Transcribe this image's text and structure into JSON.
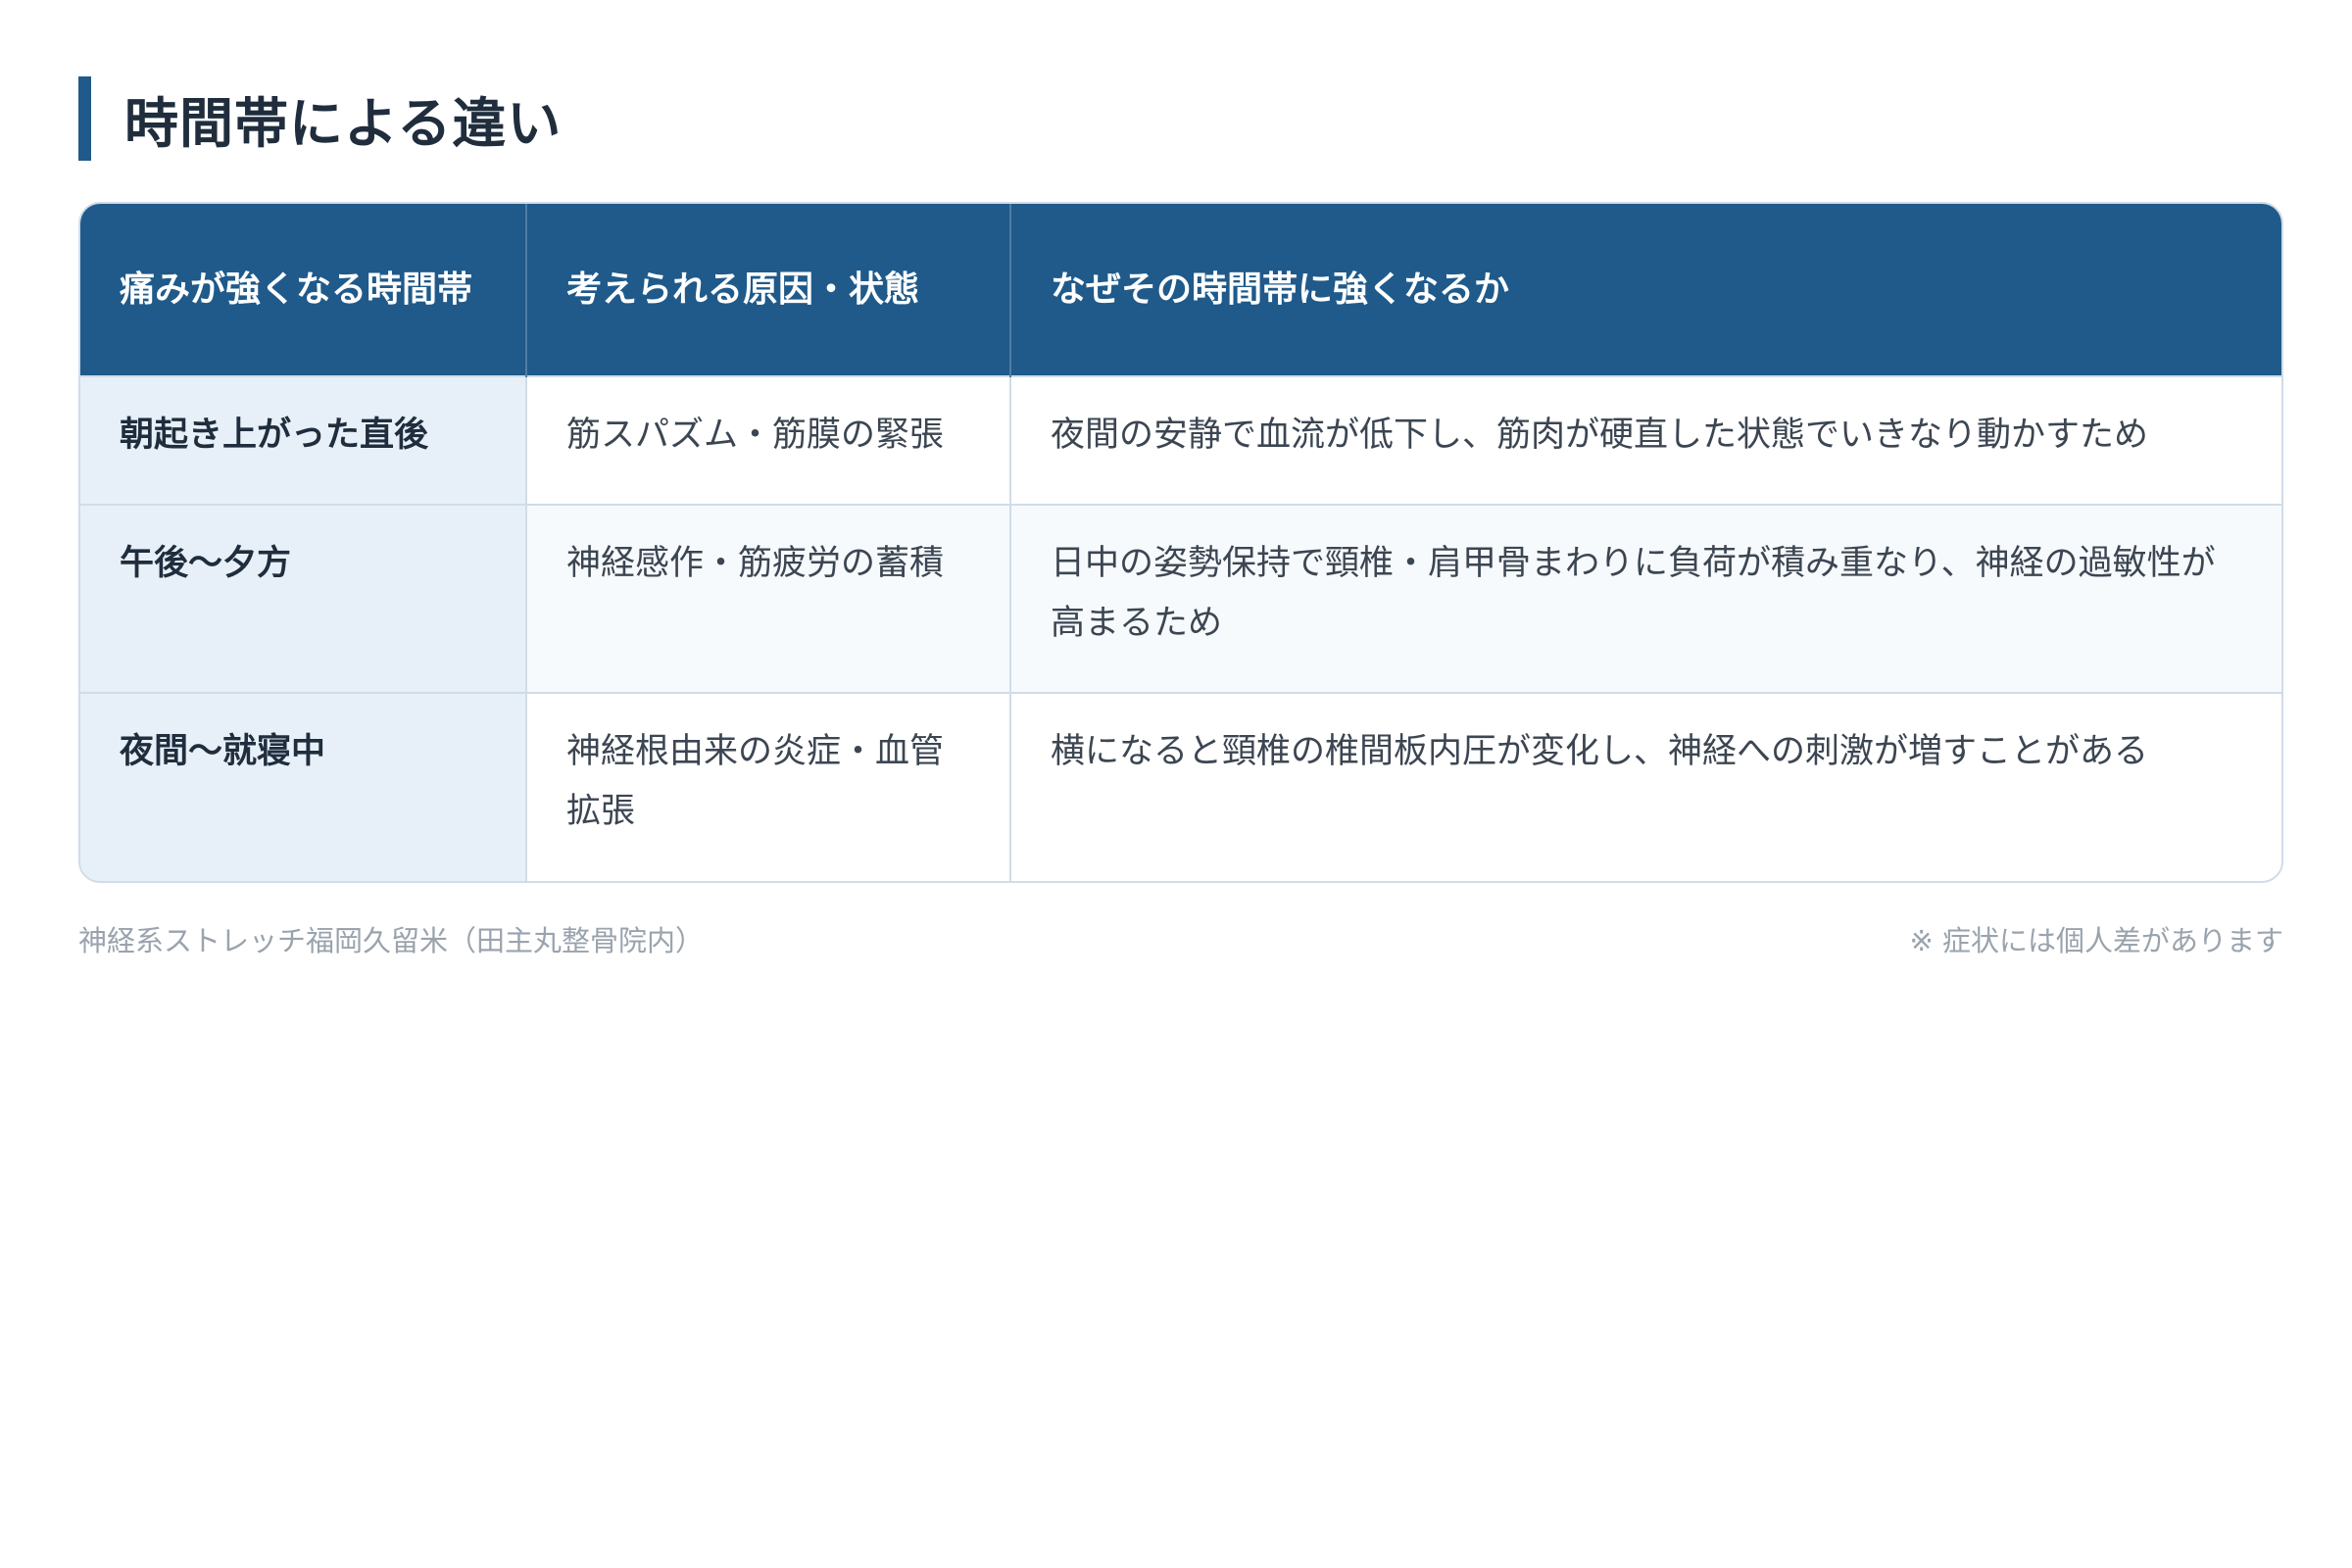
{
  "heading": "時間帯による違い",
  "table": {
    "headers": [
      "痛みが強くなる時間帯",
      "考えられる原因・状態",
      "なぜその時間帯に強くなるか"
    ],
    "rows": [
      {
        "time": "朝起き上がった直後",
        "cause": "筋スパズム・筋膜の緊張",
        "reason": "夜間の安静で血流が低下し、筋肉が硬直した状態でいきなり動かすため"
      },
      {
        "time": "午後〜夕方",
        "cause": "神経感作・筋疲労の蓄積",
        "reason": "日中の姿勢保持で頸椎・肩甲骨まわりに負荷が積み重なり、神経の過敏性が高まるため"
      },
      {
        "time": "夜間〜就寝中",
        "cause": "神経根由来の炎症・血管拡張",
        "reason": "横になると頸椎の椎間板内圧が変化し、神経への刺激が増すことがある"
      }
    ]
  },
  "footer": {
    "source": "神経系ストレッチ福岡久留米（田主丸整骨院内）",
    "note": "※ 症状には個人差があります"
  },
  "colors": {
    "header_bg": "#1f5a8a",
    "accent_bar": "#1f5a8a",
    "first_col_bg": "#e7f0f8",
    "border": "#d0dce8"
  }
}
